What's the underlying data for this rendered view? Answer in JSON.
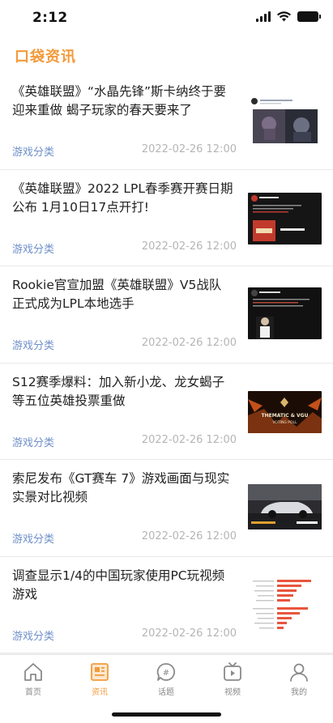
{
  "status_bar": {
    "time": "2:12"
  },
  "header": {
    "title": "口袋资讯"
  },
  "news": [
    {
      "title": "《英雄联盟》“水晶先锋”斯卡纳终于要迎来重做 蝎子玩家的春天要来了",
      "category": "游戏分类",
      "date": "2022-02-26 12:00"
    },
    {
      "title": "《英雄联盟》2022 LPL春季赛开赛日期公布 1月10日17点开打!",
      "category": "游戏分类",
      "date": "2022-02-26 12:00"
    },
    {
      "title": "Rookie官宣加盟《英雄联盟》V5战队 正式成为LPL本地选手",
      "category": "游戏分类",
      "date": "2022-02-26 12:00"
    },
    {
      "title": "S12赛季爆料：加入新小龙、龙女蝎子等五位英雄投票重做",
      "category": "游戏分类",
      "date": "2022-02-26 12:00"
    },
    {
      "title": "索尼发布《GT赛车 7》游戏画面与现实实景对比视频",
      "category": "游戏分类",
      "date": "2022-02-26 12:00"
    },
    {
      "title": "调查显示1/4的中国玩家使用PC玩视频游戏",
      "category": "游戏分类",
      "date": "2022-02-26 12:00"
    }
  ],
  "thumbnails": {
    "t4": {
      "line1": "THEMATIC & VGU",
      "line2": "VOTING POLL"
    }
  },
  "tabbar": {
    "items": [
      {
        "label": "首页",
        "icon": "home-icon"
      },
      {
        "label": "资讯",
        "icon": "news-icon",
        "active": true
      },
      {
        "label": "话题",
        "icon": "topic-icon"
      },
      {
        "label": "视频",
        "icon": "video-icon"
      },
      {
        "label": "我的",
        "icon": "profile-icon"
      }
    ]
  },
  "colors": {
    "accent": "#f39a3a",
    "category": "#6f8fc9",
    "date": "#b5b5b5"
  }
}
